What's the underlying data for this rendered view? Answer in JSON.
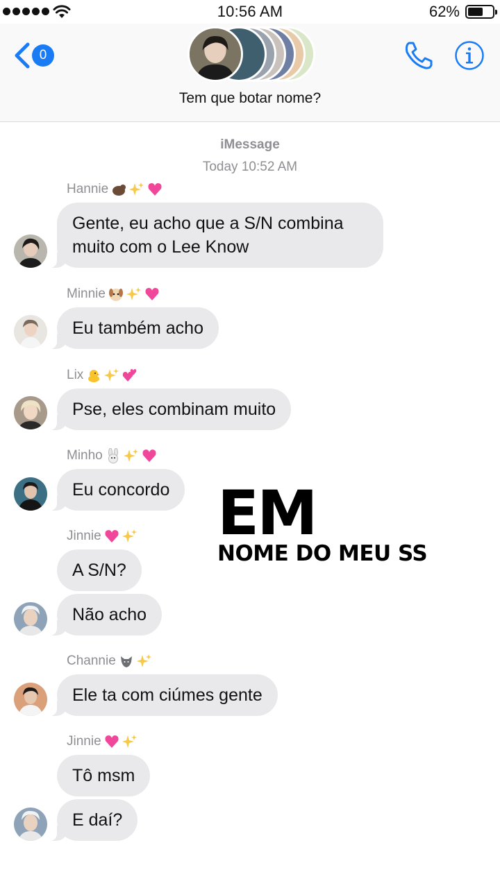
{
  "status_bar": {
    "time": "10:56 AM",
    "battery_percent": "62%",
    "battery_level": 0.62
  },
  "header": {
    "back_badge": "0",
    "group_name": "Tem que botar nome?",
    "icons": [
      "back-chevron-icon",
      "phone-icon",
      "info-icon"
    ]
  },
  "thread": {
    "service": "iMessage",
    "date_label": "Today",
    "time_label": "10:52 AM"
  },
  "messages": [
    {
      "sender": "Hannie",
      "text": "Gente, eu acho que a S/N combina muito com o Lee Know",
      "emojis": [
        "bear",
        "sparkles",
        "heart"
      ]
    },
    {
      "sender": "Minnie",
      "text": "Eu também acho",
      "emojis": [
        "puppy",
        "sparkles",
        "heart"
      ]
    },
    {
      "sender": "Lix",
      "text": "Pse, eles combinam muito",
      "emojis": [
        "chick",
        "sparkles",
        "hearts"
      ]
    },
    {
      "sender": "Minho",
      "text": "Eu concordo",
      "emojis": [
        "rabbit",
        "sparkles",
        "heart"
      ]
    },
    {
      "sender": "Jinnie",
      "text": "A S/N?",
      "text2": "Não acho",
      "emojis": [
        "heart",
        "sparkles"
      ]
    },
    {
      "sender": "Channie",
      "text": "Ele ta com ciúmes gente",
      "emojis": [
        "wolf",
        "sparkles"
      ]
    },
    {
      "sender": "Jinnie",
      "text": "Tô msm",
      "text2": "E daí?",
      "emojis": [
        "heart",
        "sparkles"
      ]
    }
  ],
  "overlay": {
    "big": "EM",
    "small": "NOME DO MEU SS"
  },
  "colors": {
    "accent": "#1a7cf5",
    "bubble": "#e9e9eb",
    "meta_text": "#8e8e93"
  }
}
